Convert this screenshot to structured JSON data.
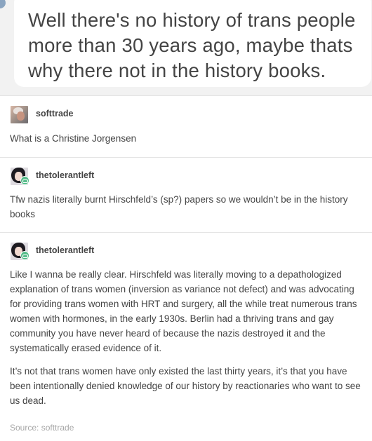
{
  "quote": {
    "text": "Well there's no history of trans people more than 30 years ago, maybe thats why there not in the history books."
  },
  "posts": [
    {
      "username": "softtrade",
      "text": "What is a Christine Jorgensen"
    },
    {
      "username": "thetolerantleft",
      "text": "Tfw nazis literally burnt Hirschfeld’s (sp?) papers so we wouldn’t be in the history books"
    },
    {
      "username": "thetolerantleft",
      "paragraphs": [
        "Like I wanna be really clear. Hirschfeld was literally moving to a depathologized explanation of trans women (inversion as variance not defect) and was advocating for providing trans women with HRT and surgery, all the while treat numerous trans women with hormones, in the early 1930s. Berlin had a thriving trans and gay community you have never heard of because the nazis destroyed it and the systematically erased evidence of it.",
        "It’s not that trans women have only existed the last thirty years, it’s that you have been intentionally denied knowledge of our history by reactionaries who want to see us dead."
      ]
    }
  ],
  "source": {
    "label": "Source: softtrade"
  },
  "colors": {
    "text": "#444444",
    "muted": "#a7a7a7",
    "badge": "#56bc8a",
    "quote_bg": "#f2f2f2"
  }
}
